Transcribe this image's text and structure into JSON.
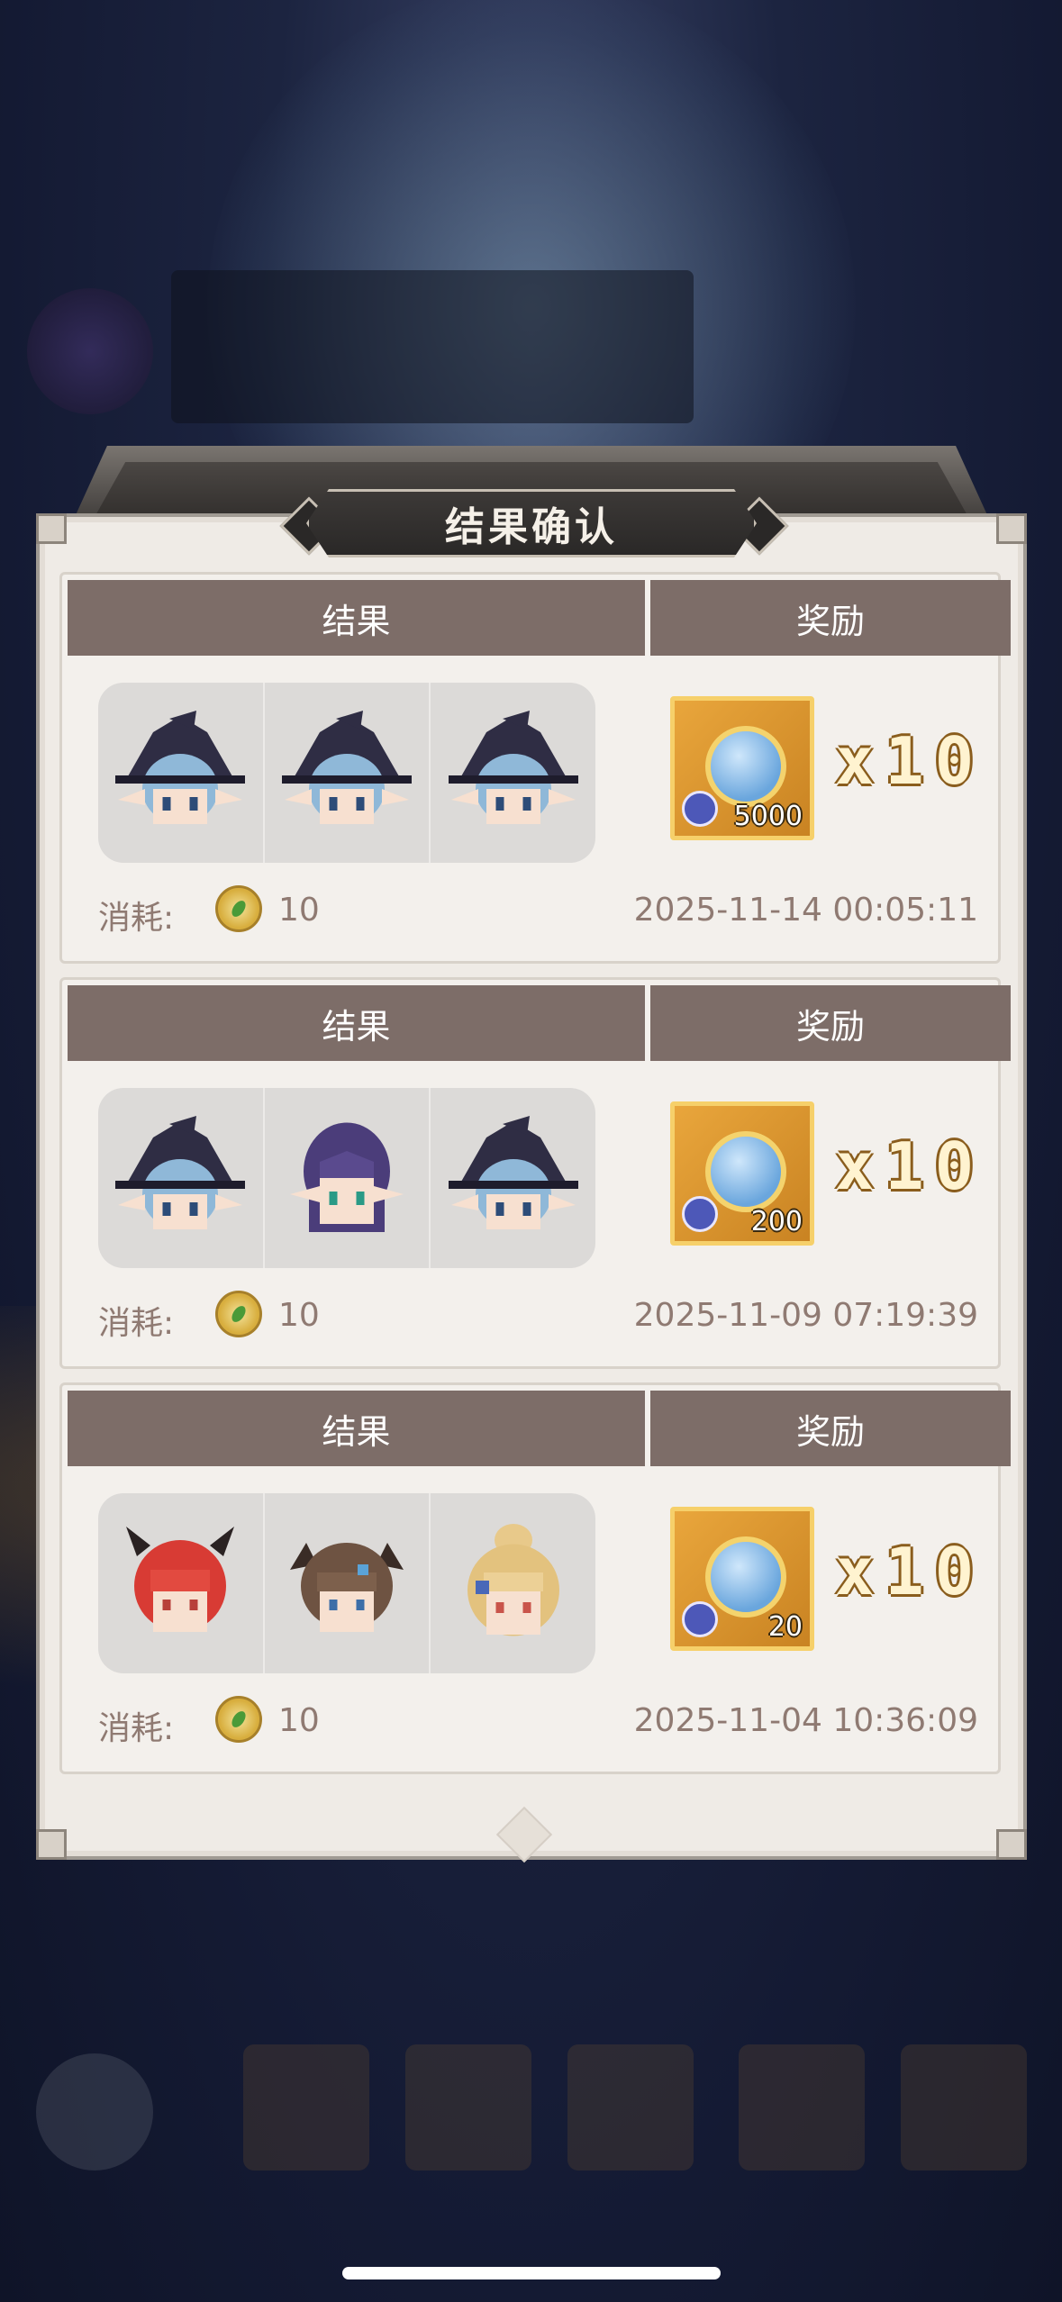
{
  "dialog": {
    "title": "结果确认"
  },
  "records": [
    {
      "result_header": "结果",
      "reward_header": "奖励",
      "heads": [
        "blue-haired-witch-head",
        "blue-haired-witch-head",
        "blue-haired-witch-head"
      ],
      "reward_quantity": "5000",
      "multiplier": "x10",
      "cost_label": "消耗:",
      "cost_value": "10",
      "timestamp": "2025-11-14 00:05:11"
    },
    {
      "result_header": "结果",
      "reward_header": "奖励",
      "heads": [
        "blue-haired-witch-head",
        "purple-haired-elf-head",
        "blue-haired-witch-head"
      ],
      "reward_quantity": "200",
      "multiplier": "x10",
      "cost_label": "消耗:",
      "cost_value": "10",
      "timestamp": "2025-11-09 07:19:39"
    },
    {
      "result_header": "结果",
      "reward_header": "奖励",
      "heads": [
        "red-haired-demon-head",
        "brown-haired-horned-head",
        "blonde-bun-head"
      ],
      "reward_quantity": "20",
      "multiplier": "x10",
      "cost_label": "消耗:",
      "cost_value": "10",
      "timestamp": "2025-11-04 10:36:09"
    }
  ],
  "colors": {
    "header_bg": "#7d6d68",
    "panel_bg": "#efebe6",
    "text_muted": "#8f7a72",
    "item_gold": "#e9a63c"
  }
}
